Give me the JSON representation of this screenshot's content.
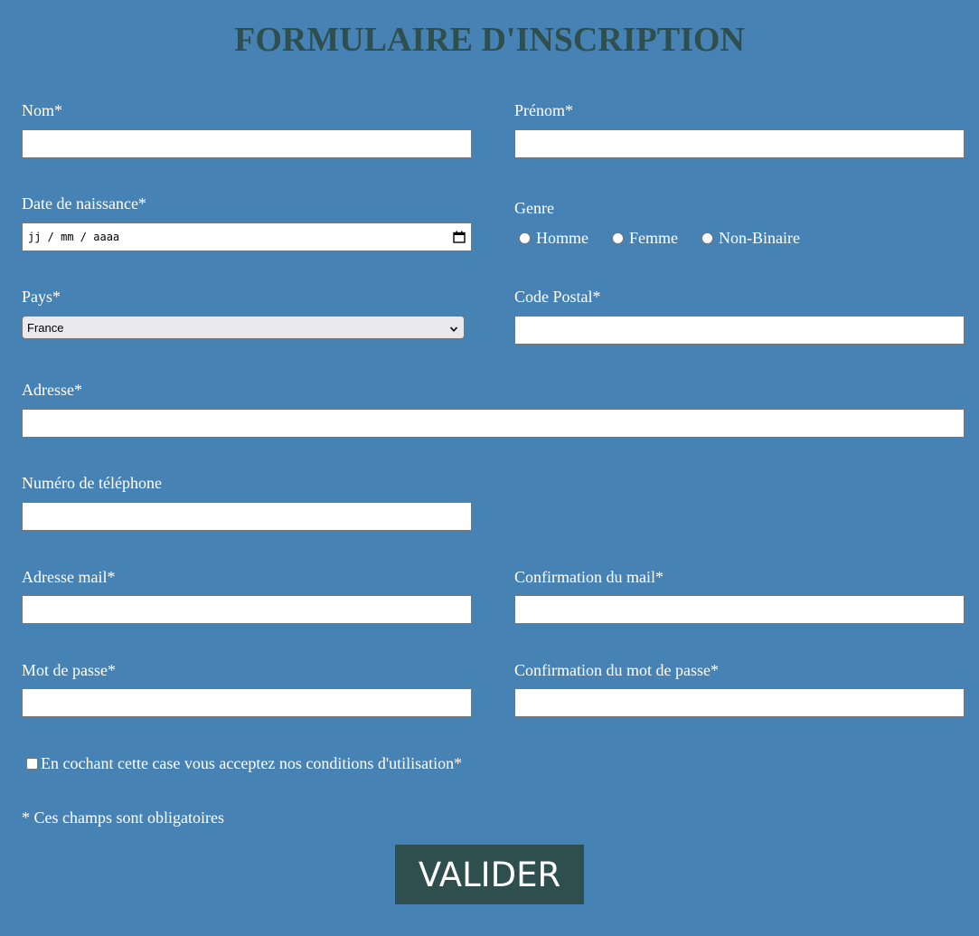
{
  "form": {
    "title": "FORMULAIRE D'INSCRIPTION",
    "nom_label": "Nom*",
    "prenom_label": "Prénom*",
    "date_label": "Date de naissance*",
    "date_placeholder": "jj / mm / aaaa",
    "genre_label": "Genre",
    "genre_options": [
      "Homme",
      "Femme",
      "Non-Binaire"
    ],
    "pays_label": "Pays*",
    "pays_value": "France",
    "code_postal_label": "Code Postal*",
    "adresse_label": "Adresse*",
    "telephone_label": "Numéro de téléphone",
    "mail_label": "Adresse mail*",
    "mail_confirm_label": "Confirmation du mail*",
    "password_label": "Mot de passe*",
    "password_confirm_label": "Confirmation du mot de passe*",
    "terms_label": "En cochant cette case vous acceptez nos conditions d'utilisation*",
    "required_note": "* Ces champs sont obligatoires",
    "submit_label": "VALIDER"
  },
  "icons": {
    "calendar": "calendar-icon",
    "select_chevron": "chevron-down-icon"
  },
  "colors": {
    "background": "#4682b4",
    "title": "#2f4f4f",
    "button": "#2f4f4f",
    "text": "#ffffff"
  }
}
